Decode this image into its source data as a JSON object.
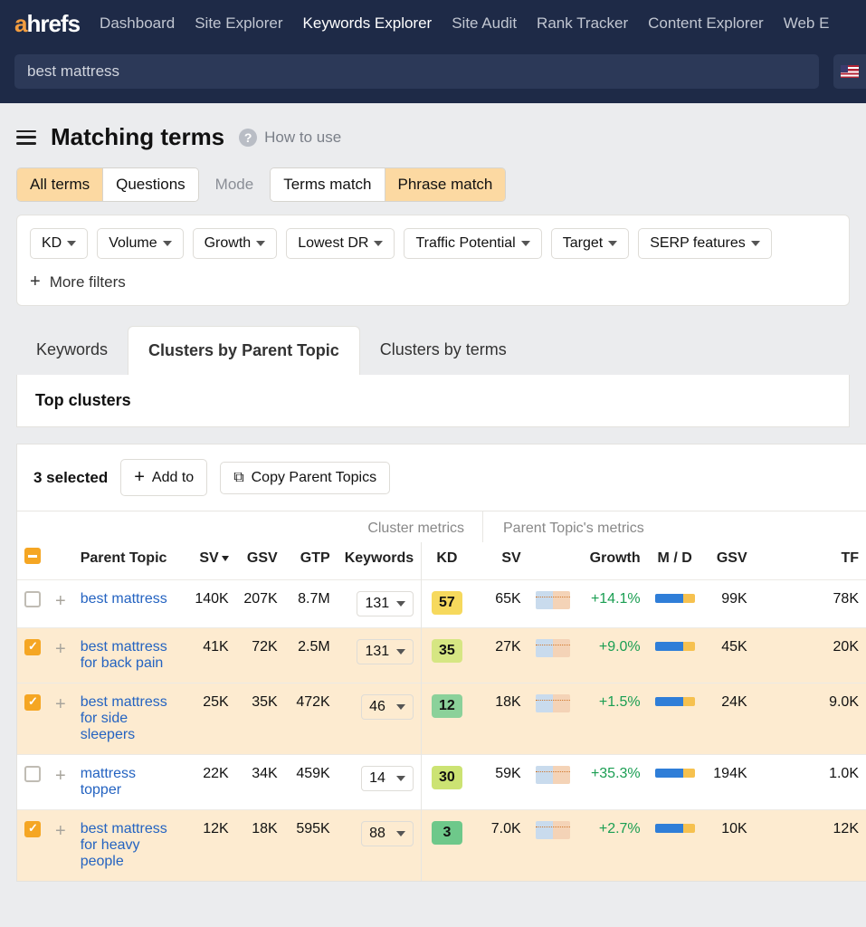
{
  "logo": {
    "a": "a",
    "rest": "hrefs"
  },
  "nav": [
    "Dashboard",
    "Site Explorer",
    "Keywords Explorer",
    "Site Audit",
    "Rank Tracker",
    "Content Explorer",
    "Web E"
  ],
  "nav_active_index": 2,
  "search_value": "best mattress",
  "page_title": "Matching terms",
  "how_to_use": "How to use",
  "seg1": {
    "all": "All terms",
    "questions": "Questions"
  },
  "mode_label": "Mode",
  "seg2": {
    "terms": "Terms match",
    "phrase": "Phrase match"
  },
  "filters": [
    "KD",
    "Volume",
    "Growth",
    "Lowest DR",
    "Traffic Potential",
    "Target",
    "SERP features"
  ],
  "more_filters": "More filters",
  "tabs": [
    "Keywords",
    "Clusters by Parent Topic",
    "Clusters by terms"
  ],
  "tabs_active_index": 1,
  "subheader": "Top clusters",
  "selected_text": "3 selected",
  "add_to": "Add to",
  "copy_parent": "Copy Parent Topics",
  "cluster_metrics_label": "Cluster metrics",
  "parent_metrics_label": "Parent Topic's metrics",
  "headers": {
    "parent_topic": "Parent Topic",
    "sv": "SV",
    "gsv": "GSV",
    "gtp": "GTP",
    "keywords": "Keywords",
    "kd": "KD",
    "sv2": "SV",
    "growth": "Growth",
    "md": "M / D",
    "gsv2": "GSV",
    "tp": "TF"
  },
  "rows": [
    {
      "checked": false,
      "topic": "best mattress",
      "sv": "140K",
      "gsv": "207K",
      "gtp": "8.7M",
      "kw": "131",
      "kd": "57",
      "kdClass": "kd-yellow",
      "sv2": "65K",
      "growth": "+14.1%",
      "gsv2": "99K",
      "tp": "78K"
    },
    {
      "checked": true,
      "topic": "best mattress for back pain",
      "sv": "41K",
      "gsv": "72K",
      "gtp": "2.5M",
      "kw": "131",
      "kd": "35",
      "kdClass": "kd-lime",
      "sv2": "27K",
      "growth": "+9.0%",
      "gsv2": "45K",
      "tp": "20K"
    },
    {
      "checked": true,
      "topic": "best mattress for side sleepers",
      "sv": "25K",
      "gsv": "35K",
      "gtp": "472K",
      "kw": "46",
      "kd": "12",
      "kdClass": "kd-green",
      "sv2": "18K",
      "growth": "+1.5%",
      "gsv2": "24K",
      "tp": "9.0K"
    },
    {
      "checked": false,
      "topic": "mattress topper",
      "sv": "22K",
      "gsv": "34K",
      "gtp": "459K",
      "kw": "14",
      "kd": "30",
      "kdClass": "kd-ygreen",
      "sv2": "59K",
      "growth": "+35.3%",
      "gsv2": "194K",
      "tp": "1.0K"
    },
    {
      "checked": true,
      "topic": "best mattress for heavy people",
      "sv": "12K",
      "gsv": "18K",
      "gtp": "595K",
      "kw": "88",
      "kd": "3",
      "kdClass": "kd-dgreen",
      "sv2": "7.0K",
      "growth": "+2.7%",
      "gsv2": "10K",
      "tp": "12K"
    }
  ]
}
